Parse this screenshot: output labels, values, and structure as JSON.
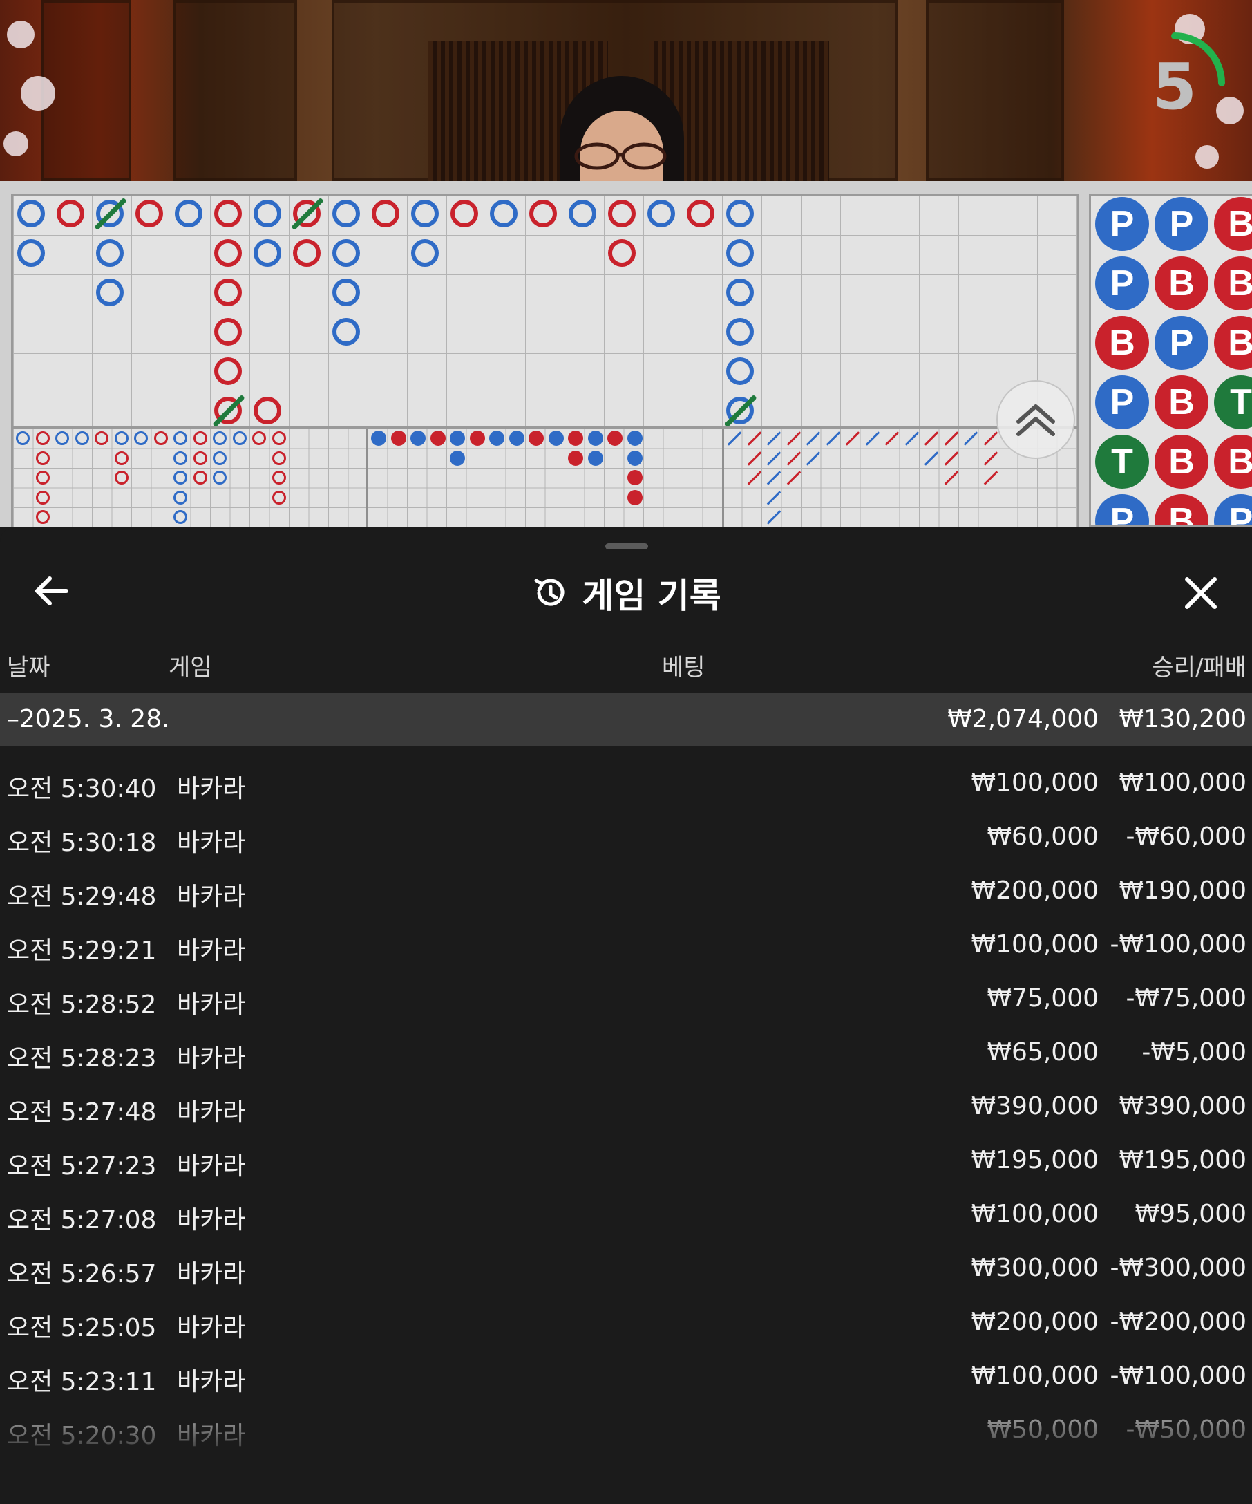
{
  "video": {
    "countdown": "5",
    "countdown_progress": 0.25
  },
  "colors": {
    "player": "#2f6bc6",
    "banker": "#c9222c",
    "tie": "#1f7a3c",
    "timer": "#22b14c"
  },
  "scoreboard": {
    "bead_plate": [
      [
        "P",
        "P",
        "B"
      ],
      [
        "P",
        "B",
        "B"
      ],
      [
        "B",
        "P",
        "B"
      ],
      [
        "P",
        "B",
        "T"
      ],
      [
        "T",
        "B",
        "B"
      ],
      [
        "P",
        "B",
        "P"
      ]
    ],
    "expand_icon": "chevron-double-up-icon"
  },
  "history": {
    "title": "게임 기록",
    "title_icon": "history-icon",
    "back_icon": "arrow-left-icon",
    "close_icon": "close-icon",
    "columns": {
      "date": "날짜",
      "game": "게임",
      "bet": "베팅",
      "win_loss": "승리/패배"
    },
    "date_group": {
      "label": "–2025. 3. 28.",
      "bet_total": "₩2,074,000",
      "win_total": "₩130,200"
    },
    "rows": [
      {
        "time": "오전 5:30:40",
        "game": "바카라",
        "bet": "₩100,000",
        "win": "₩100,000"
      },
      {
        "time": "오전 5:30:18",
        "game": "바카라",
        "bet": "₩60,000",
        "win": "-₩60,000"
      },
      {
        "time": "오전 5:29:48",
        "game": "바카라",
        "bet": "₩200,000",
        "win": "₩190,000"
      },
      {
        "time": "오전 5:29:21",
        "game": "바카라",
        "bet": "₩100,000",
        "win": "-₩100,000"
      },
      {
        "time": "오전 5:28:52",
        "game": "바카라",
        "bet": "₩75,000",
        "win": "-₩75,000"
      },
      {
        "time": "오전 5:28:23",
        "game": "바카라",
        "bet": "₩65,000",
        "win": "-₩5,000"
      },
      {
        "time": "오전 5:27:48",
        "game": "바카라",
        "bet": "₩390,000",
        "win": "₩390,000"
      },
      {
        "time": "오전 5:27:23",
        "game": "바카라",
        "bet": "₩195,000",
        "win": "₩195,000"
      },
      {
        "time": "오전 5:27:08",
        "game": "바카라",
        "bet": "₩100,000",
        "win": "₩95,000"
      },
      {
        "time": "오전 5:26:57",
        "game": "바카라",
        "bet": "₩300,000",
        "win": "-₩300,000"
      },
      {
        "time": "오전 5:25:05",
        "game": "바카라",
        "bet": "₩200,000",
        "win": "-₩200,000"
      },
      {
        "time": "오전 5:23:11",
        "game": "바카라",
        "bet": "₩100,000",
        "win": "-₩100,000"
      },
      {
        "time": "오전 5:20:30",
        "game": "바카라",
        "bet": "₩50,000",
        "win": "-₩50,000"
      }
    ]
  }
}
